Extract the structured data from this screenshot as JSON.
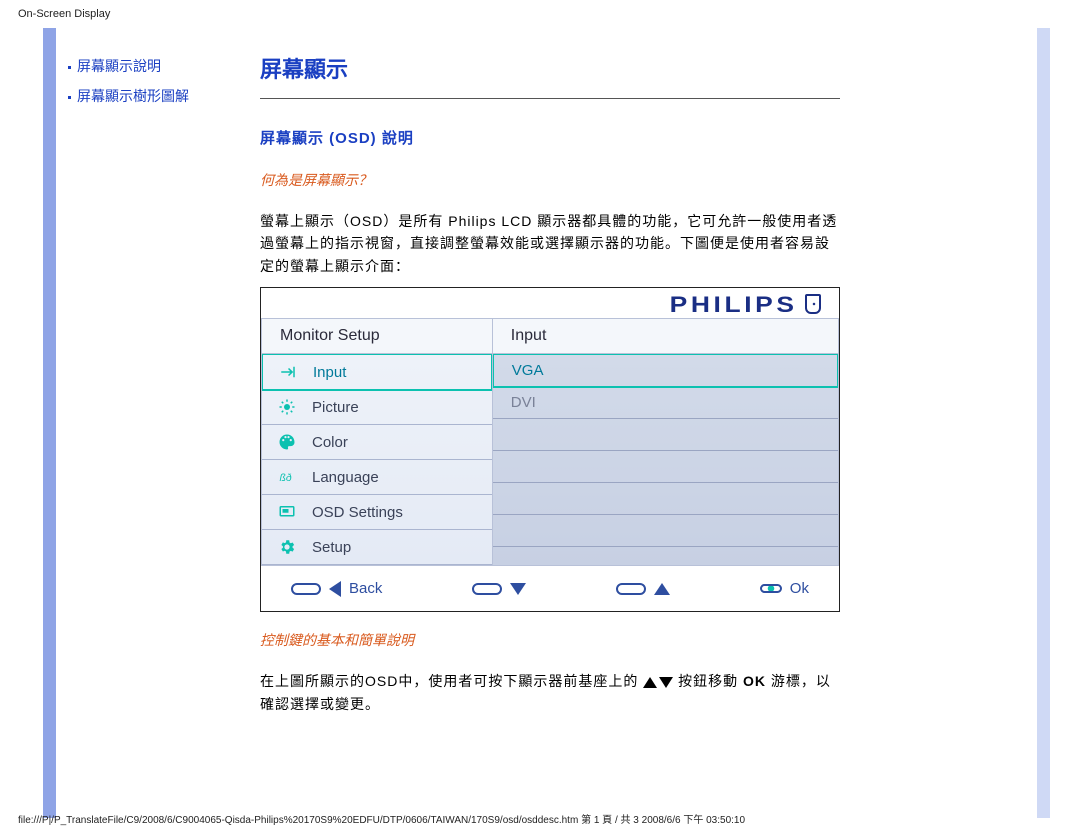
{
  "header": {
    "title": "On-Screen Display"
  },
  "sidebar": {
    "links": [
      {
        "label": "屏幕顯示說明"
      },
      {
        "label": "屏幕顯示樹形圖解"
      }
    ]
  },
  "content": {
    "title": "屏幕顯示",
    "section_heading": "屏幕顯示 (OSD) 說明",
    "q_heading": "何為是屏幕顯示？",
    "para1": "螢幕上顯示（OSD）是所有 Philips LCD 顯示器都具體的功能，它可允許一般使用者透過螢幕上的指示視窗，直接調整螢幕效能或選擇顯示器的功能。下圖便是使用者容易設定的螢幕上顯示介面：",
    "osd": {
      "brand": "PHILIPS",
      "col_left": "Monitor Setup",
      "col_right": "Input",
      "menu": [
        {
          "icon": "input-icon",
          "label": "Input",
          "active": true
        },
        {
          "icon": "picture-icon",
          "label": "Picture"
        },
        {
          "icon": "color-icon",
          "label": "Color"
        },
        {
          "icon": "language-icon",
          "label": "Language"
        },
        {
          "icon": "osd-settings-icon",
          "label": "OSD Settings"
        },
        {
          "icon": "setup-icon",
          "label": "Setup"
        }
      ],
      "sub": [
        {
          "label": "VGA",
          "active": true
        },
        {
          "label": "DVI"
        }
      ],
      "footer": {
        "back": "Back",
        "ok": "Ok"
      }
    },
    "orange2": "控制鍵的基本和簡單說明",
    "para2_a": "在上圖所顯示的OSD中，使用者可按下顯示器前基座上的 ",
    "para2_b": " 按鈕移動 ",
    "para2_c": " 游標，以確認選擇或變更。",
    "ok_inline": "OK"
  },
  "footer_path": "file:///P|/P_TranslateFile/C9/2008/6/C9004065-Qisda-Philips%20170S9%20EDFU/DTP/0606/TAIWAN/170S9/osd/osddesc.htm 第 1 頁 / 共 3 2008/6/6 下午 03:50:10"
}
